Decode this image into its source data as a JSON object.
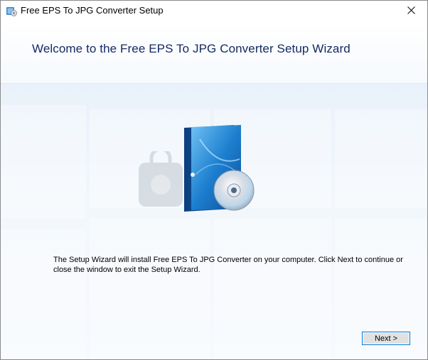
{
  "window": {
    "title": "Free EPS To JPG Converter Setup",
    "close_icon": "close-icon"
  },
  "header": {
    "welcome_title": "Welcome to the Free EPS To JPG Converter Setup Wizard"
  },
  "content": {
    "product_image_icon": "software-box-cd-icon",
    "description": "The Setup Wizard will install Free EPS To JPG Converter on your computer. Click Next to continue or close the window to exit the Setup Wizard."
  },
  "buttons": {
    "next_label": "Next >"
  },
  "colors": {
    "title_text": "#142a63",
    "button_border": "#0078d7",
    "button_bg": "#e1e1e1",
    "content_bg": "#eef4fb"
  }
}
